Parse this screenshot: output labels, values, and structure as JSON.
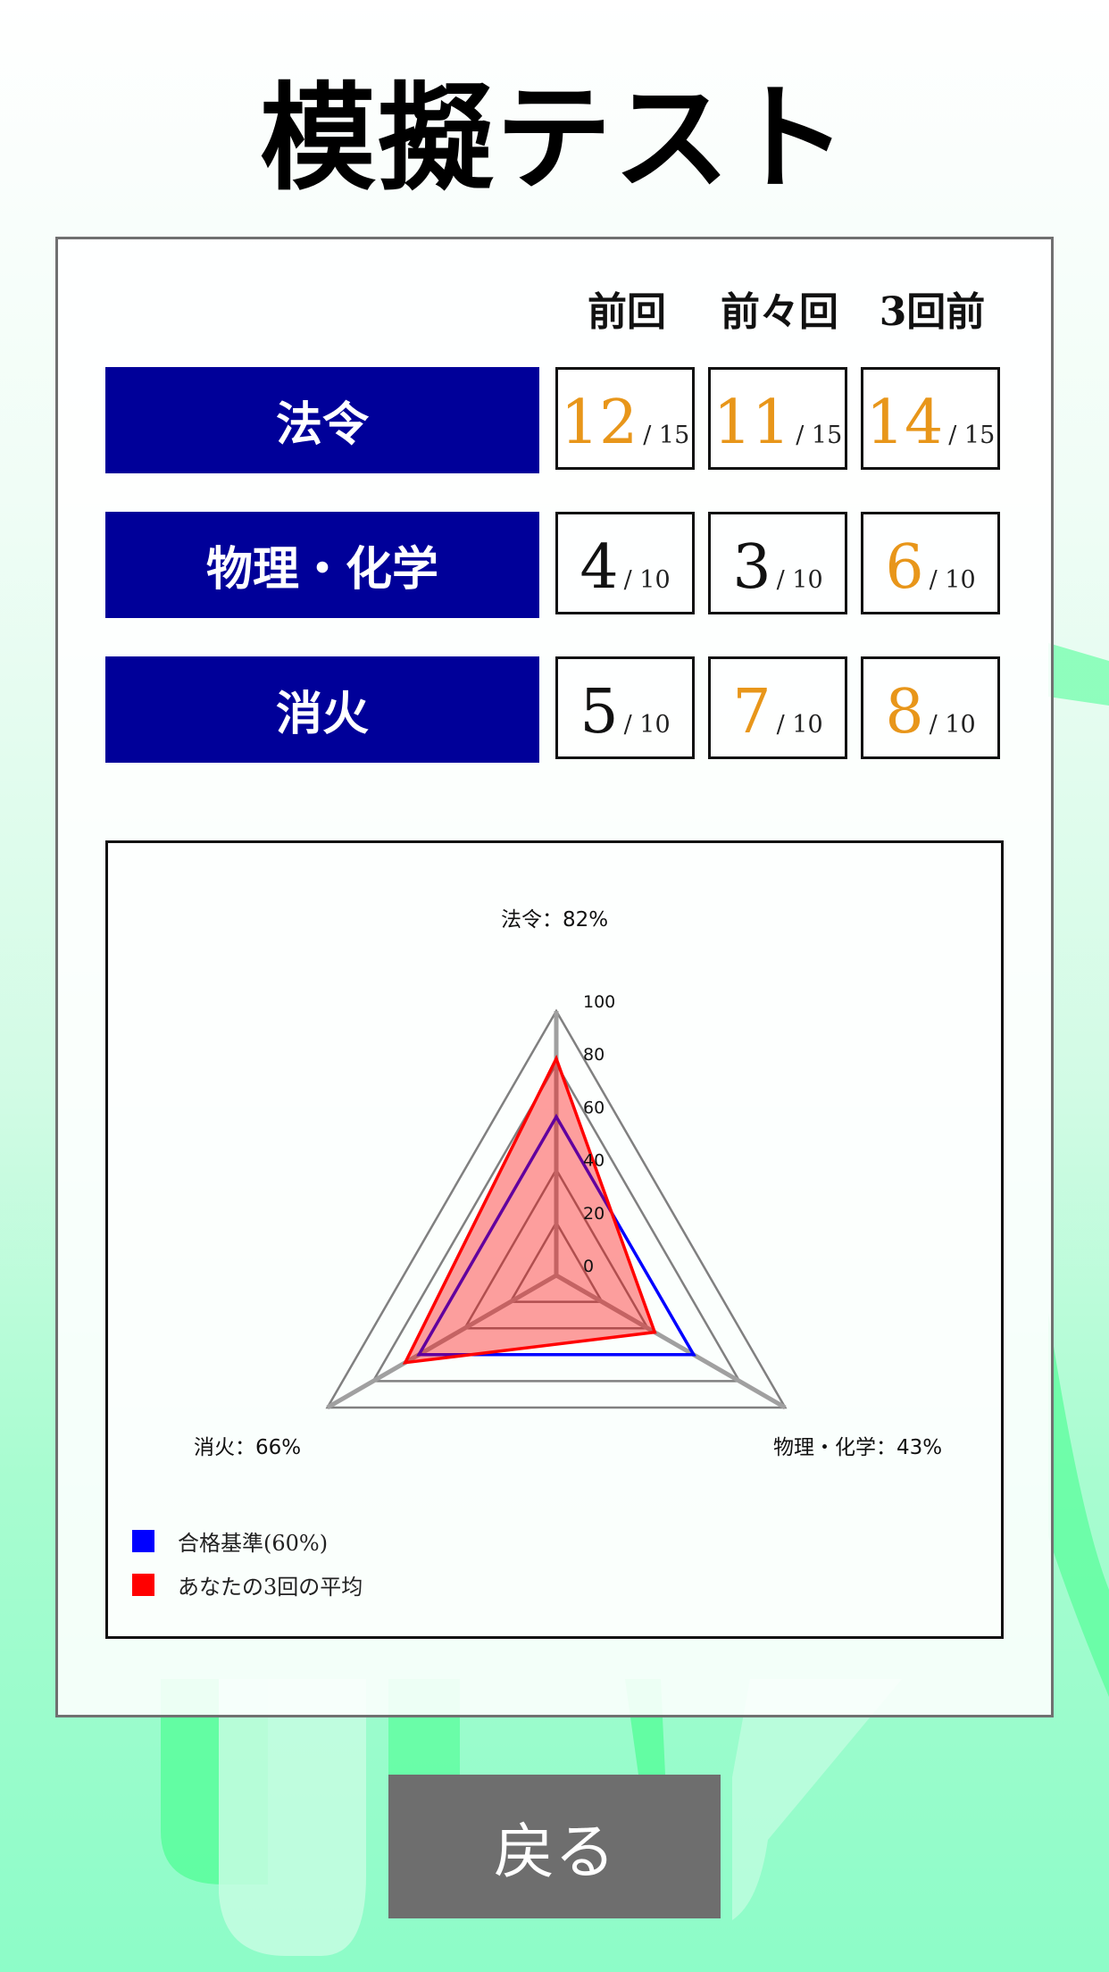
{
  "title": "模擬テスト",
  "columns": [
    "前回",
    "前々回",
    "3回前"
  ],
  "rows": [
    {
      "label": "法令",
      "scores": [
        {
          "value": "12",
          "max": "/ 15",
          "highlight": true
        },
        {
          "value": "11",
          "max": "/ 15",
          "highlight": true
        },
        {
          "value": "14",
          "max": "/ 15",
          "highlight": true
        }
      ]
    },
    {
      "label": "物理・化学",
      "scores": [
        {
          "value": "4",
          "max": "/ 10",
          "highlight": false
        },
        {
          "value": "3",
          "max": "/ 10",
          "highlight": false
        },
        {
          "value": "6",
          "max": "/ 10",
          "highlight": true
        }
      ]
    },
    {
      "label": "消火",
      "scores": [
        {
          "value": "5",
          "max": "/ 10",
          "highlight": false
        },
        {
          "value": "7",
          "max": "/ 10",
          "highlight": true
        },
        {
          "value": "8",
          "max": "/ 10",
          "highlight": true
        }
      ]
    }
  ],
  "colors": {
    "label_bg": "#000099",
    "highlight": "#e8961a",
    "pass_line": "#0000ff",
    "average": "#ff0000",
    "button_bg": "#6e6e6e"
  },
  "chart_data": {
    "type": "radar",
    "axes": [
      "法令",
      "物理・化学",
      "消火"
    ],
    "axis_labels": [
      "法令：82%",
      "物理・化学：43%",
      "消火：66%"
    ],
    "scale": {
      "min": 0,
      "max": 100,
      "ticks": [
        "0",
        "20",
        "40",
        "60",
        "80",
        "100"
      ]
    },
    "series": [
      {
        "name": "合格基準(60%)",
        "values": [
          60,
          60,
          60
        ],
        "color": "#0000ff",
        "fill": false
      },
      {
        "name": "あなたの3回の平均",
        "values": [
          82,
          43,
          66
        ],
        "color": "#ff0000",
        "fill": true
      }
    ],
    "legend": "bottom-left"
  },
  "back_button": {
    "label": "戻る"
  }
}
